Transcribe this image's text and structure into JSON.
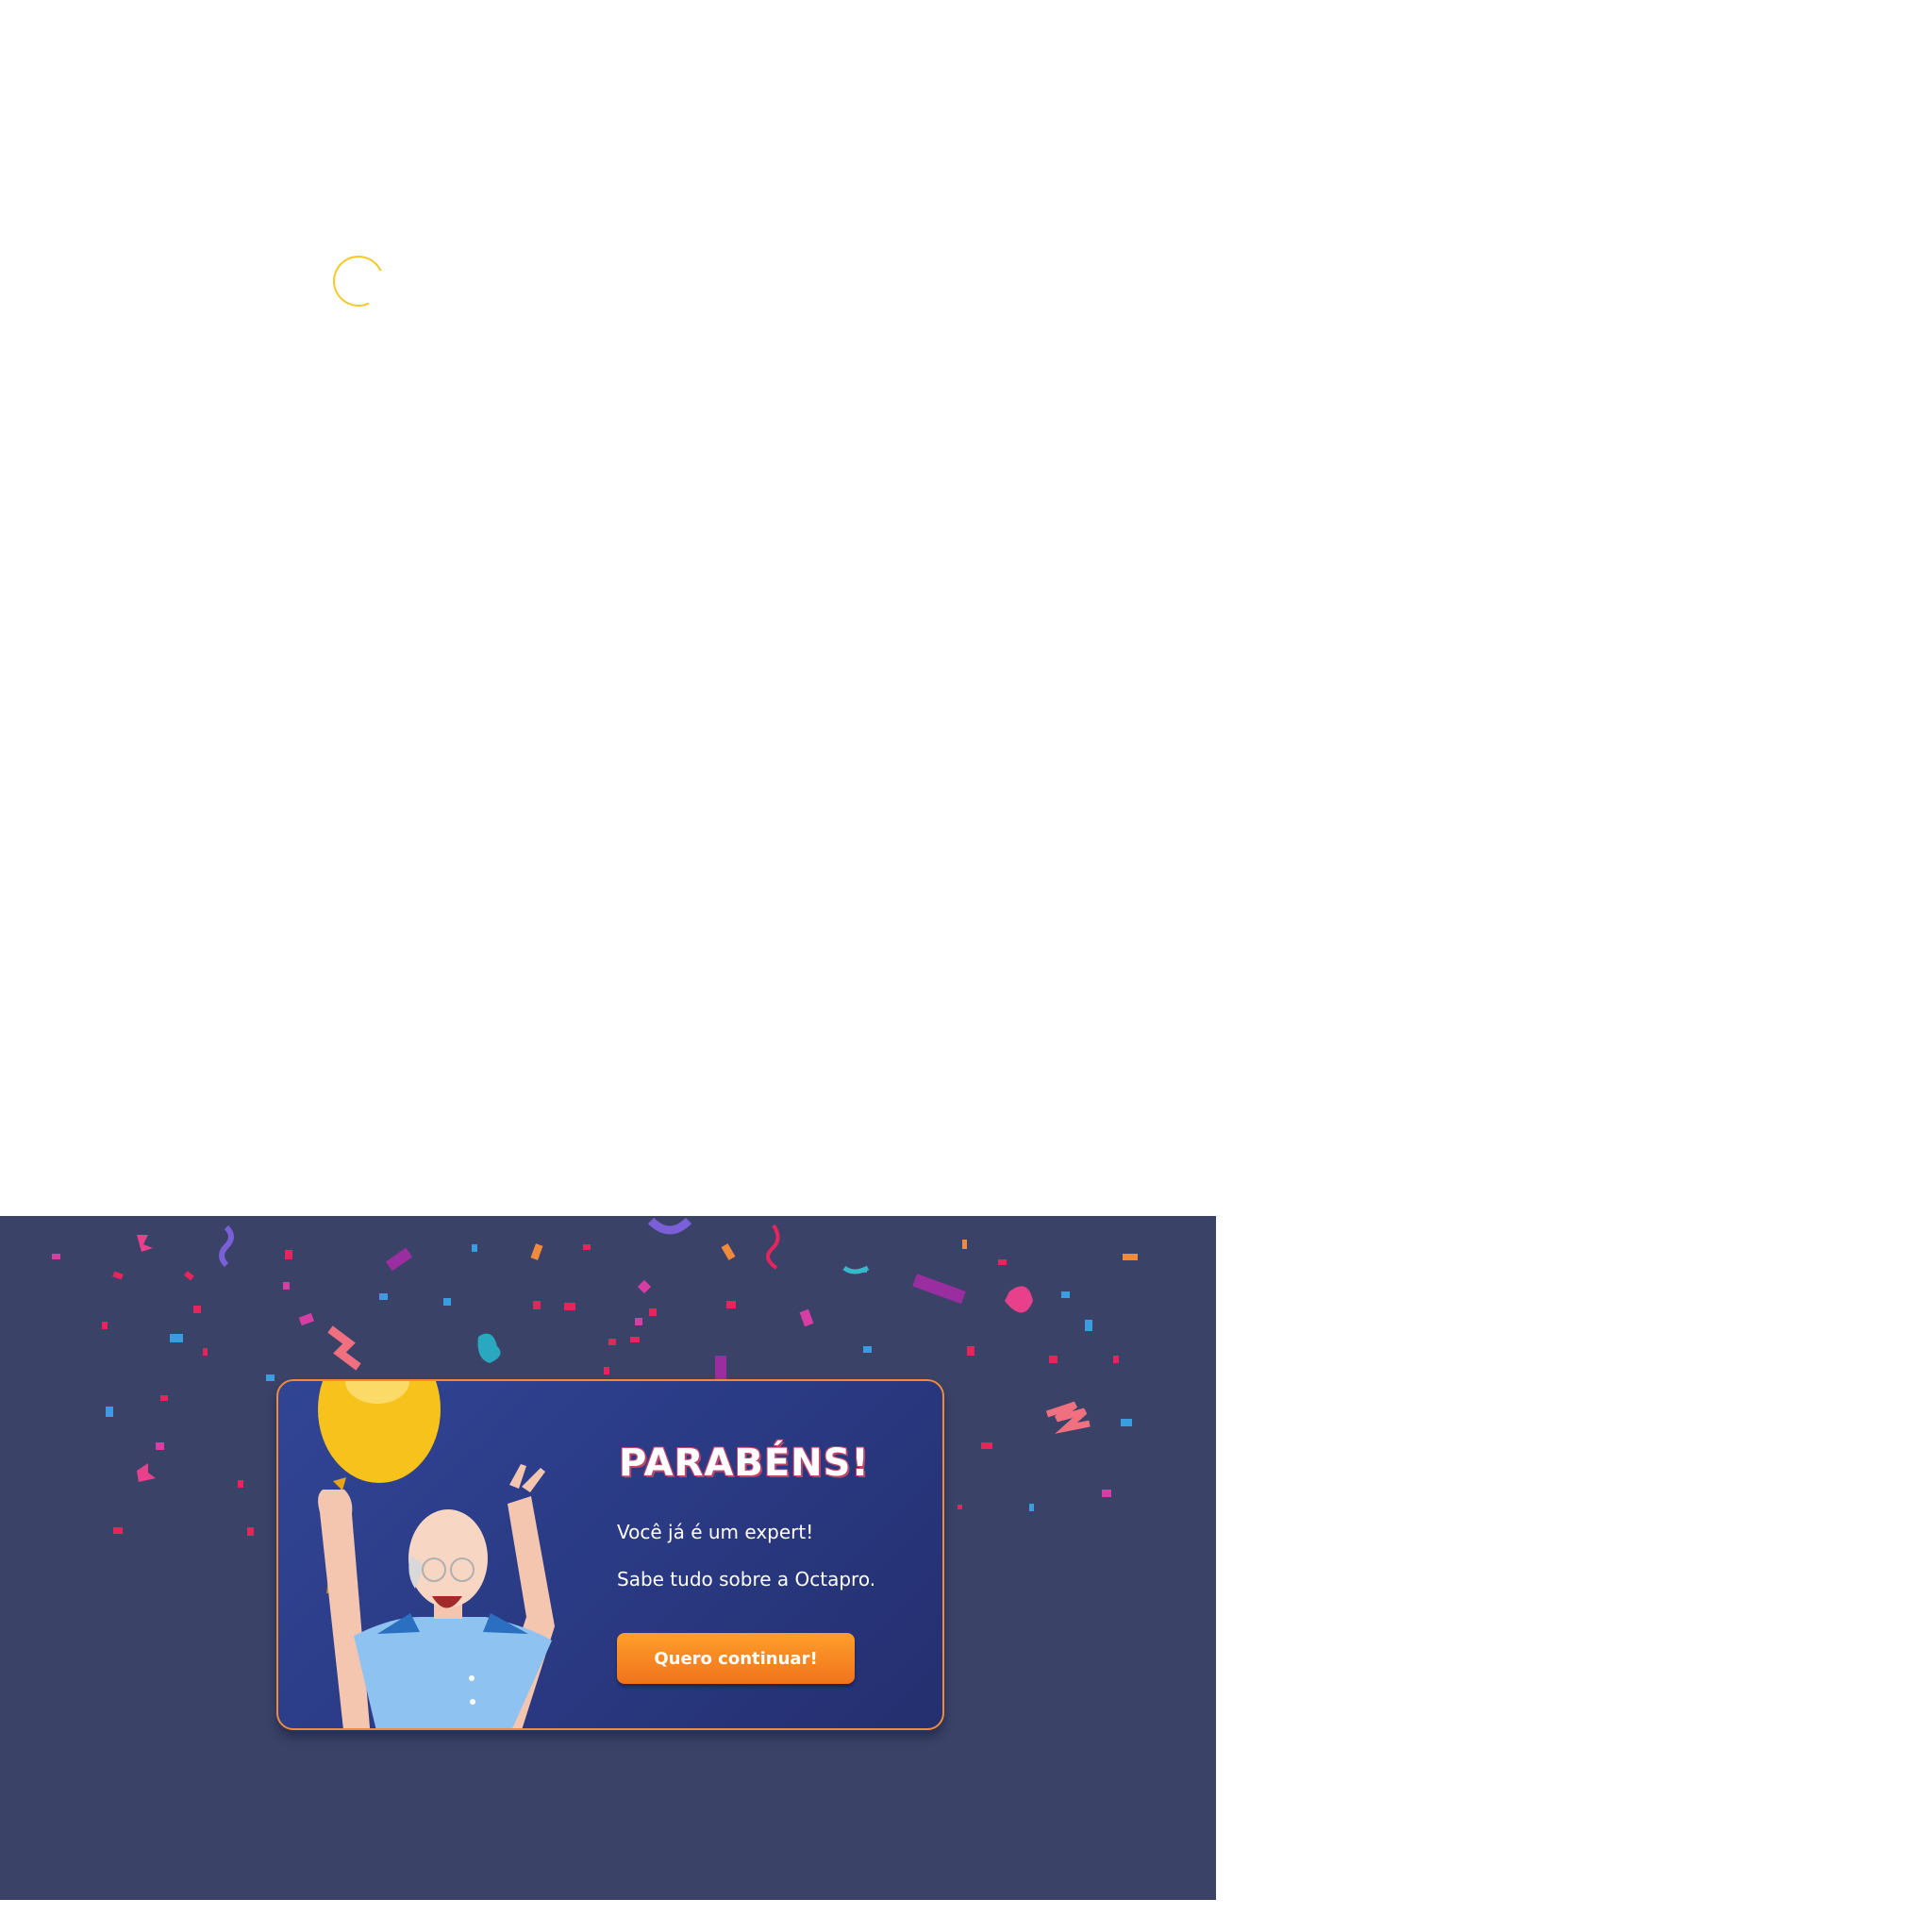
{
  "congrats": {
    "title": "PARABÉNS!",
    "line1": "Você já é um expert!",
    "line2": "Sabe tudo sobre a Octapro.",
    "button_label": "Quero continuar!"
  },
  "colors": {
    "panel_bg": "#3a4268",
    "card_border": "#f08a3c",
    "button": "#f7861f",
    "spinner": "#f6c928"
  },
  "icons": {
    "loading": "loading-spinner-icon",
    "illustration": "celebrating-man-with-balloon",
    "decoration": "confetti"
  }
}
